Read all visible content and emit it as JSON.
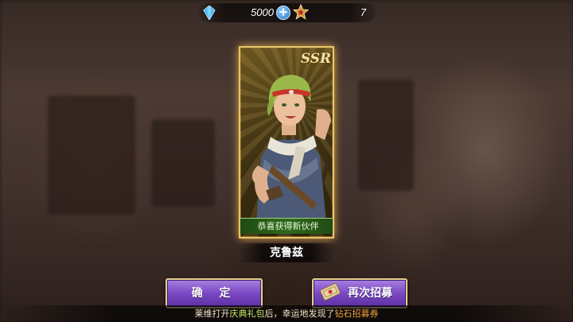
{
  "currency": {
    "gems": "5000",
    "stars": "7",
    "gem_icon": "blue-crystal-icon",
    "star_icon": "star-medal-icon",
    "plus_label": "+"
  },
  "card": {
    "rarity": "SSR",
    "congrats_text": "恭喜获得新伙伴",
    "character_name": "克鲁兹"
  },
  "buttons": {
    "confirm_label": "确 定",
    "again_label": "再次招募",
    "ticket_icon": "recruit-ticket-icon"
  },
  "notice": {
    "player": "莱维",
    "mid1": "打开",
    "pack": "庆典礼包",
    "mid2": "后，幸运地发现了",
    "item": "钻石招募券"
  },
  "colors": {
    "button_purple": "#7b49c4",
    "button_border": "#e6cf8e",
    "card_gold": "#e9c46a",
    "congrats_green": "#2f6a1c"
  }
}
